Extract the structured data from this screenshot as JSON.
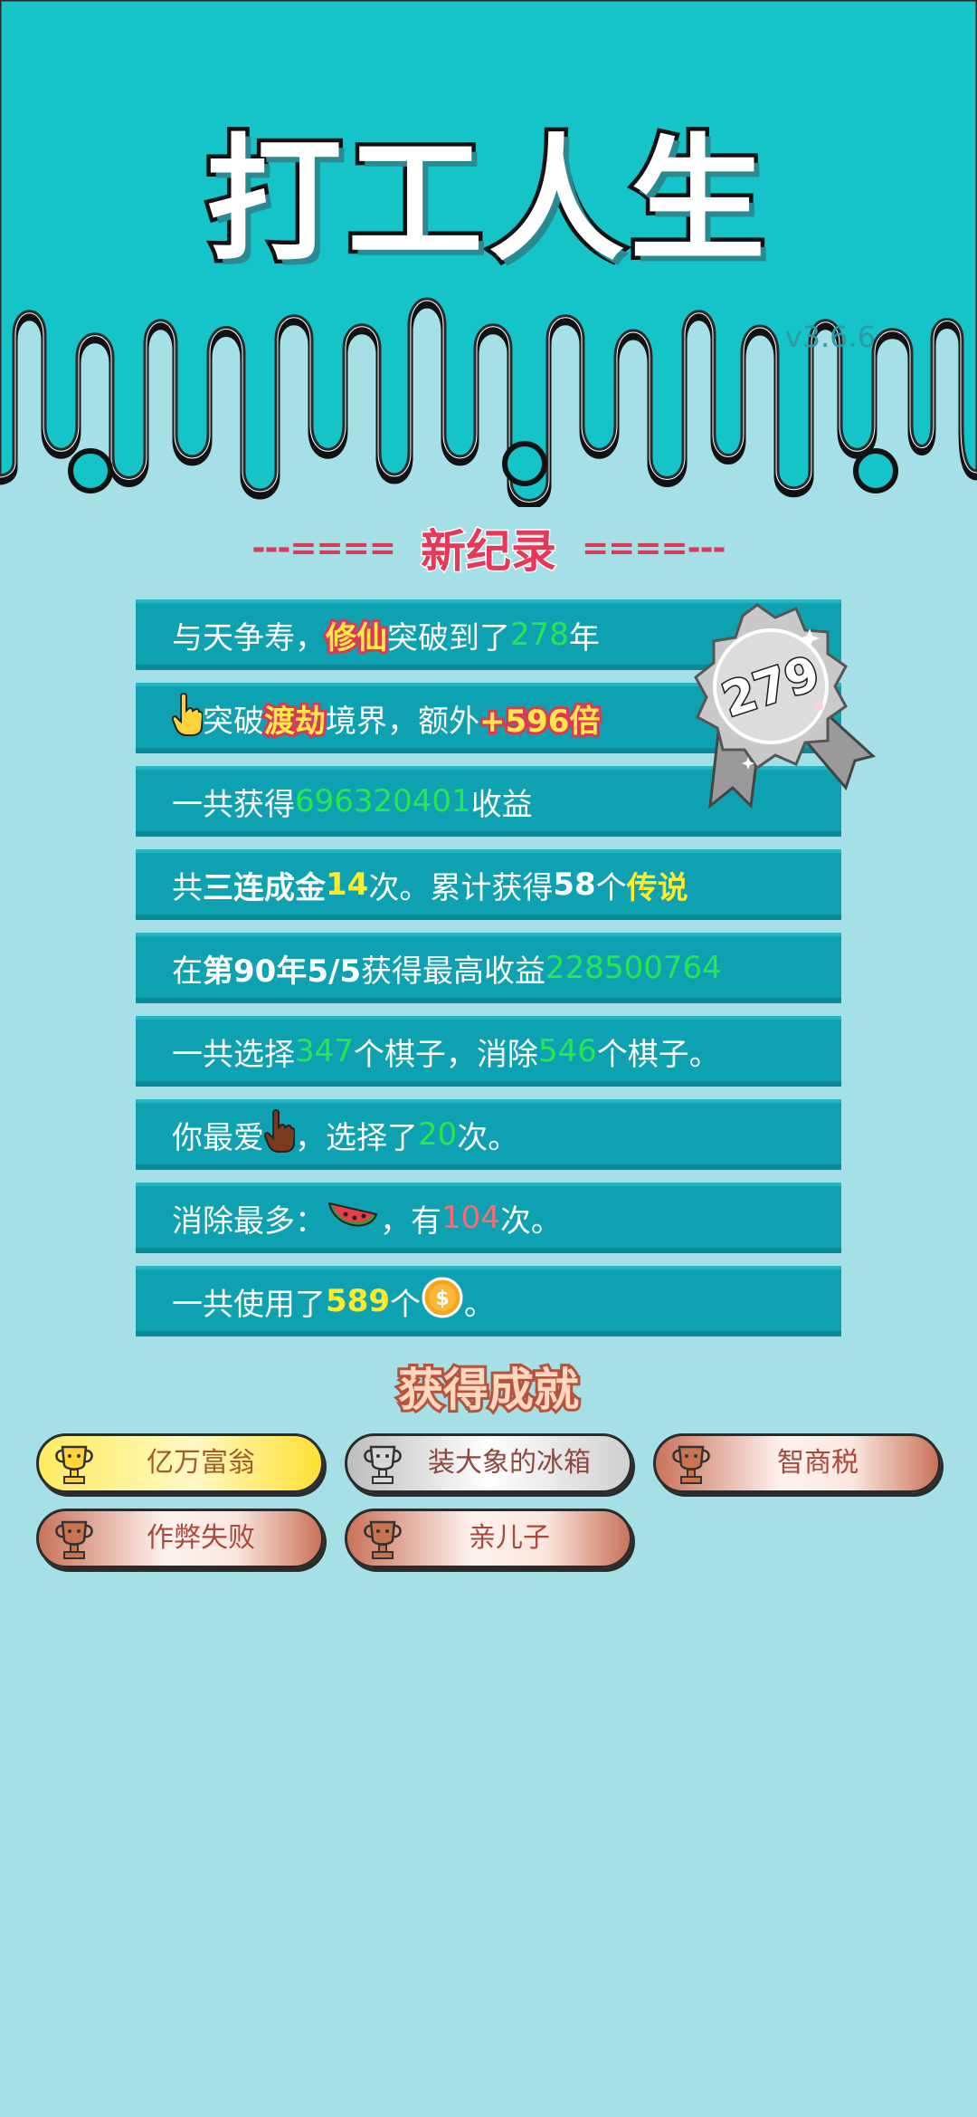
{
  "header": {
    "title": "打工人生",
    "version": "v3.6.6"
  },
  "record": {
    "dashes_left": "---====",
    "title": "新纪录",
    "dashes_right": "====---"
  },
  "medal": {
    "value": "279"
  },
  "stats": {
    "r1": {
      "a": "与天争寿，",
      "b": "修仙",
      "c": "突破到了",
      "d": "278",
      "e": "年"
    },
    "r2": {
      "a": "突破",
      "b": "渡劫",
      "c": "境界，额外",
      "d": "+596倍"
    },
    "r3": {
      "a": "一共获得",
      "b": "696320401",
      "c": "收益"
    },
    "r4": {
      "a": "共",
      "b": "三连成金",
      "c": "14",
      "d": "次。累计获得",
      "e": "58",
      "f": "个",
      "g": "传说"
    },
    "r5": {
      "a": "在 ",
      "b": "第90年5/5",
      "c": " 获得最高收益",
      "d": "228500764"
    },
    "r6": {
      "a": "一共选择",
      "b": "347",
      "c": "个棋子，消除",
      "d": "546",
      "e": "个棋子。"
    },
    "r7": {
      "a": "你最爱",
      "b": "，选择了",
      "c": "20",
      "d": "次。"
    },
    "r8": {
      "a": "消除最多：",
      "b": "，有",
      "c": "104",
      "d": "次。"
    },
    "r9": {
      "a": "一共使用了",
      "b": "589",
      "c": "个",
      "d": "。"
    }
  },
  "achievements": {
    "title": "获得成就",
    "items": [
      {
        "label": "亿万富翁",
        "tier": "gold"
      },
      {
        "label": "装大象的冰箱",
        "tier": "silver"
      },
      {
        "label": "智商税",
        "tier": "bronze"
      },
      {
        "label": "作弊失败",
        "tier": "bronze"
      },
      {
        "label": "亲儿子",
        "tier": "bronze"
      }
    ]
  },
  "icons": {
    "hand": "pointing-hand-icon",
    "hand_dark": "pointing-hand-dark-icon",
    "watermelon": "watermelon-icon",
    "coin": "coin-icon",
    "trophy": "trophy-icon",
    "medal": "medal-icon"
  },
  "colors": {
    "background": "#a4e0e6",
    "header": "#14c4c8",
    "row": "#0ea1b1",
    "accent_green": "#27e84a",
    "accent_yellow": "#ffeb2a",
    "accent_red": "#ff6a72",
    "record_red": "#e8385a"
  }
}
